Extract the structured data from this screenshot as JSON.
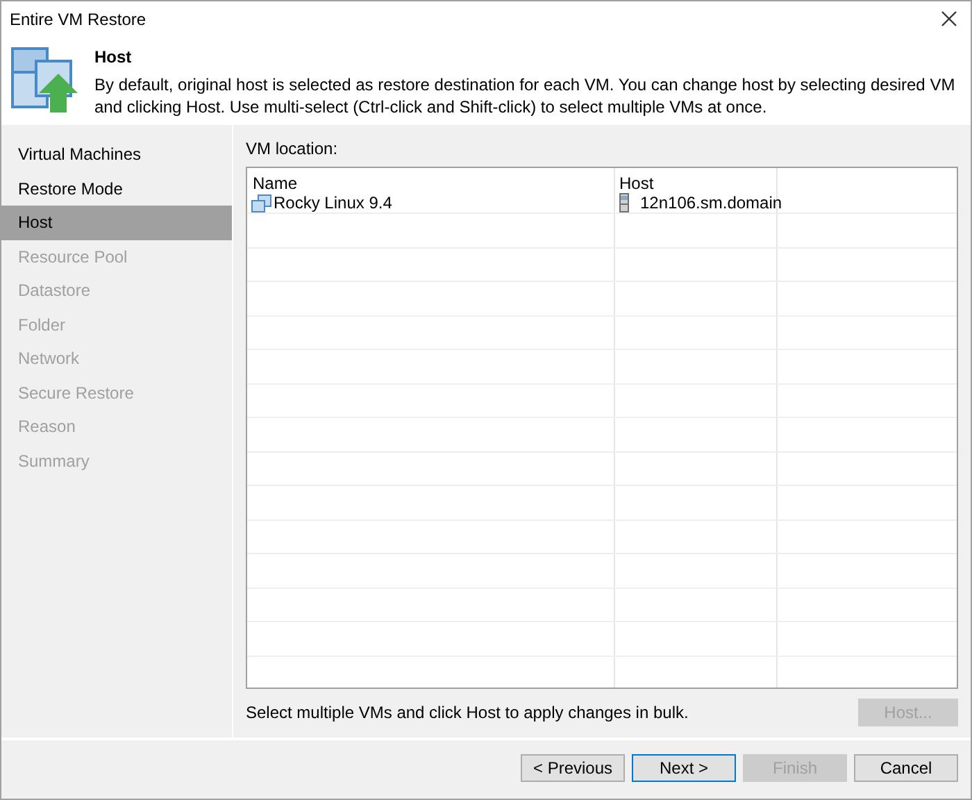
{
  "window": {
    "title": "Entire VM Restore"
  },
  "header": {
    "title": "Host",
    "description": "By default, original host is selected as restore destination for each VM. You can change host by selecting desired VM and clicking Host. Use multi-select (Ctrl-click and Shift-click) to select multiple VMs at once."
  },
  "sidebar": {
    "items": [
      {
        "label": "Virtual Machines",
        "disabled": false,
        "selected": false
      },
      {
        "label": "Restore Mode",
        "disabled": false,
        "selected": false
      },
      {
        "label": "Host",
        "disabled": false,
        "selected": true
      },
      {
        "label": "Resource Pool",
        "disabled": true,
        "selected": false
      },
      {
        "label": "Datastore",
        "disabled": true,
        "selected": false
      },
      {
        "label": "Folder",
        "disabled": true,
        "selected": false
      },
      {
        "label": "Network",
        "disabled": true,
        "selected": false
      },
      {
        "label": "Secure Restore",
        "disabled": true,
        "selected": false
      },
      {
        "label": "Reason",
        "disabled": true,
        "selected": false
      },
      {
        "label": "Summary",
        "disabled": true,
        "selected": false
      }
    ]
  },
  "table": {
    "label": "VM location:",
    "columns": [
      "Name",
      "Host"
    ],
    "rows": [
      {
        "name": "Rocky Linux 9.4",
        "host": "12n106.sm.domain",
        "selected": false
      }
    ]
  },
  "hint": "Select multiple VMs and click Host to apply changes in bulk.",
  "host_button": {
    "label": "Host...",
    "disabled": true
  },
  "buttons": [
    {
      "label": "< Previous",
      "disabled": false,
      "default": false
    },
    {
      "label": "Next >",
      "disabled": false,
      "default": true
    },
    {
      "label": "Finish",
      "disabled": true,
      "default": false
    },
    {
      "label": "Cancel",
      "disabled": false,
      "default": false
    }
  ]
}
